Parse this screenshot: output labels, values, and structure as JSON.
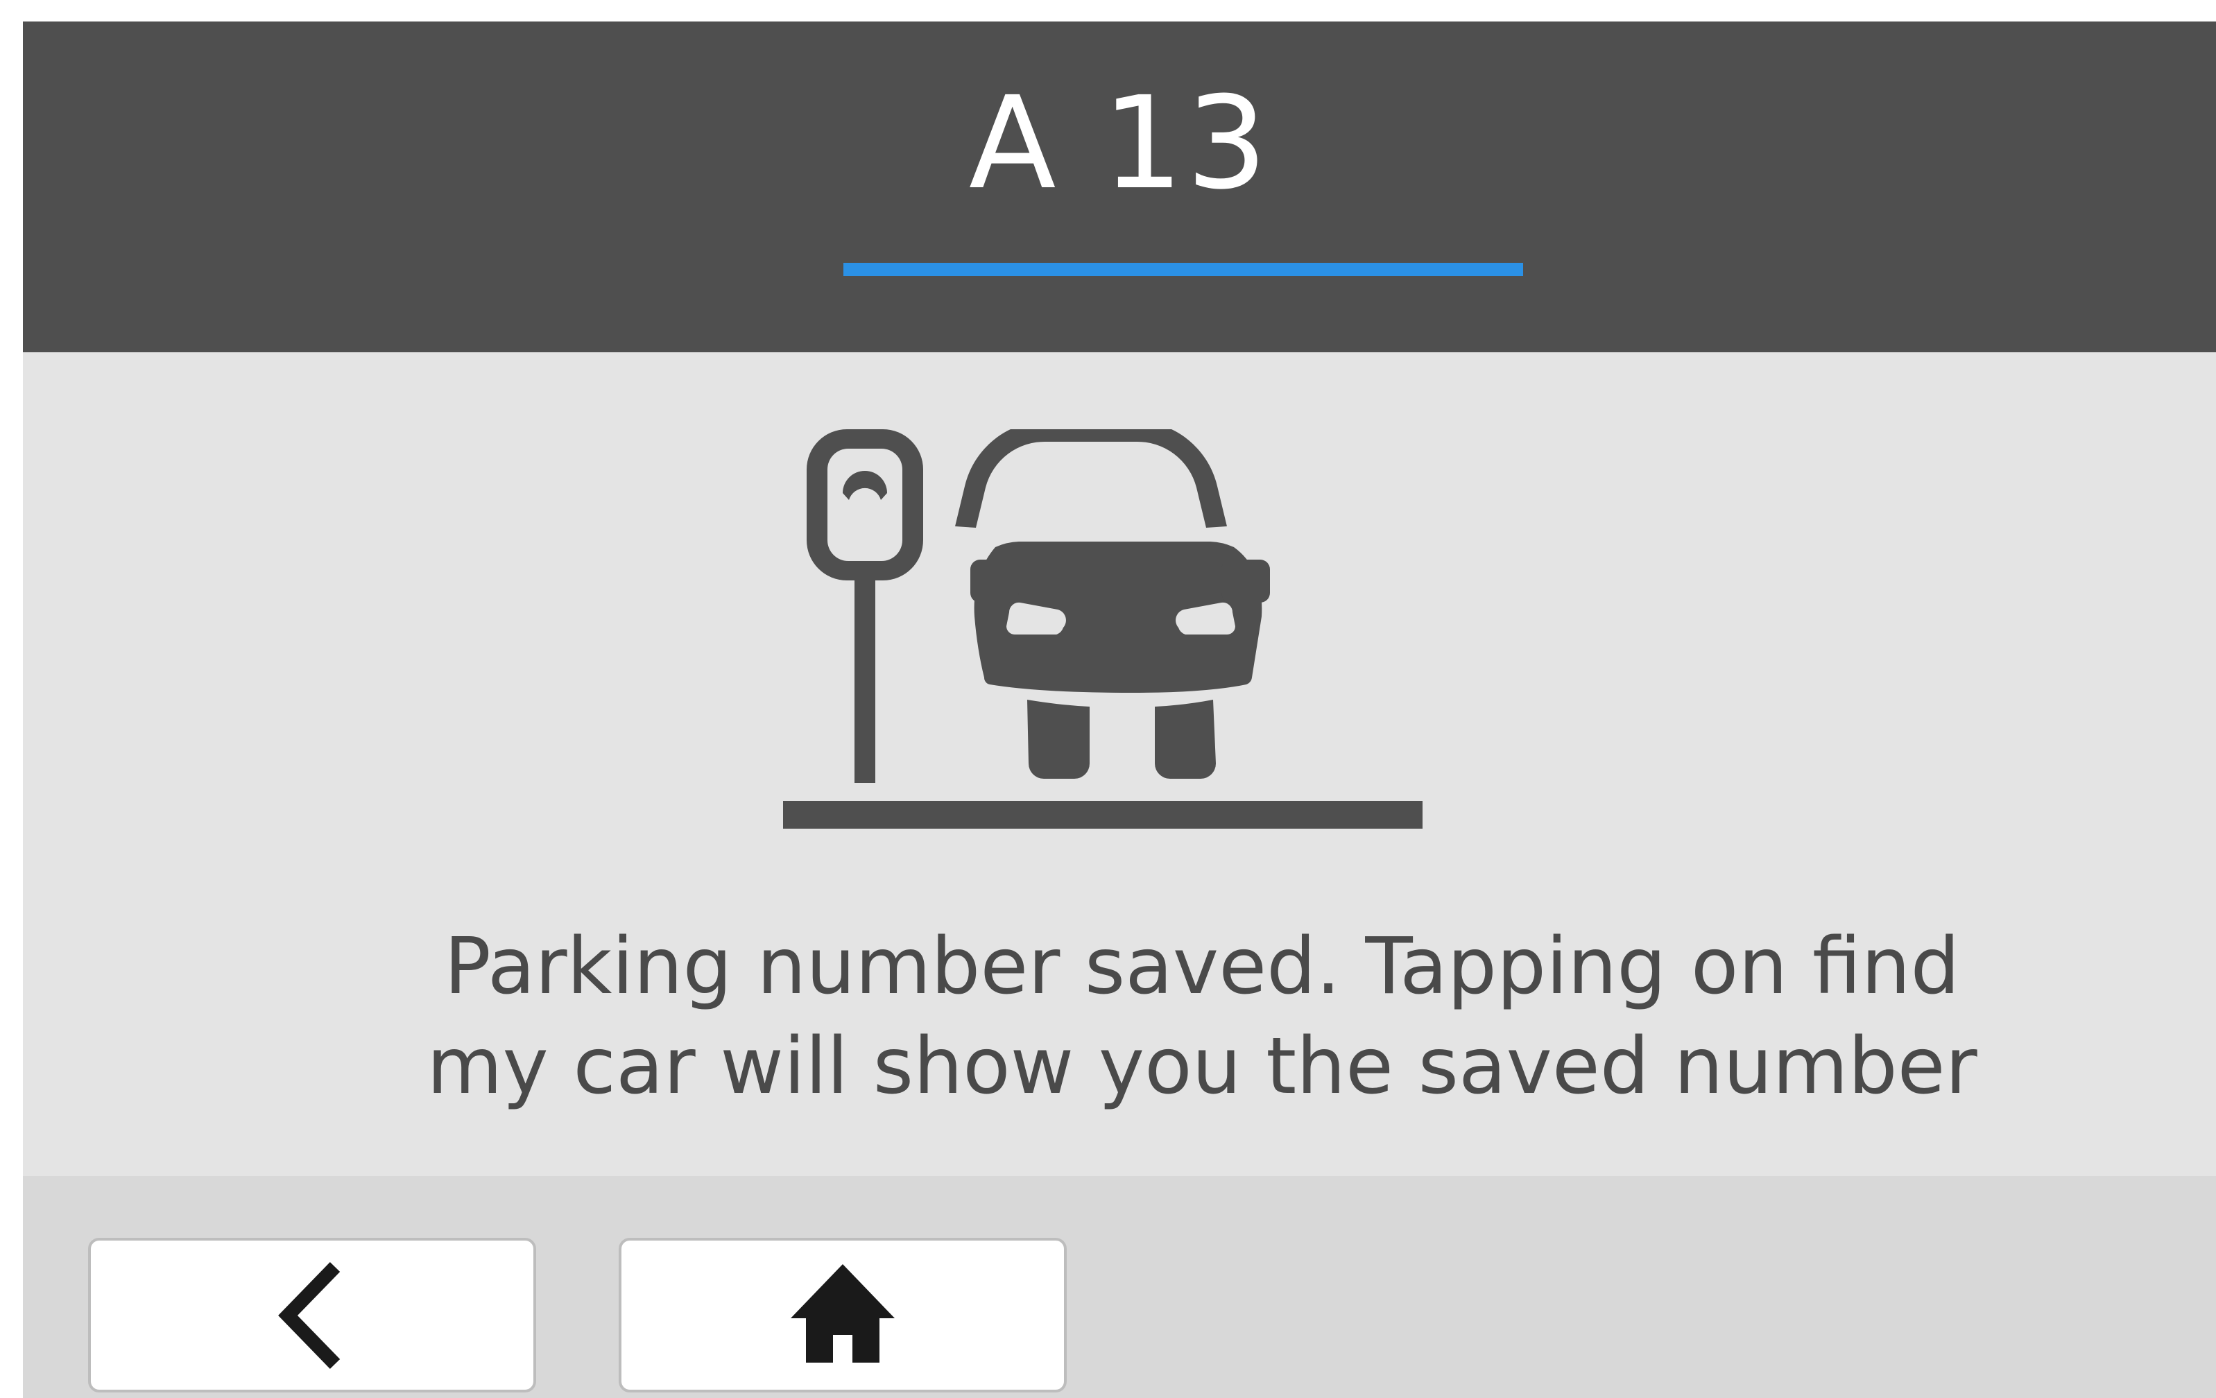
{
  "header": {
    "title": "A 13",
    "underline_color": "#2b91e6"
  },
  "illustration": {
    "icon": "parking-meter-car-icon"
  },
  "message": {
    "line1": "Parking number saved. Tapping on find",
    "line2": "my car will show you the saved number"
  },
  "footer": {
    "back_icon": "chevron-left-icon",
    "home_icon": "home-icon"
  }
}
